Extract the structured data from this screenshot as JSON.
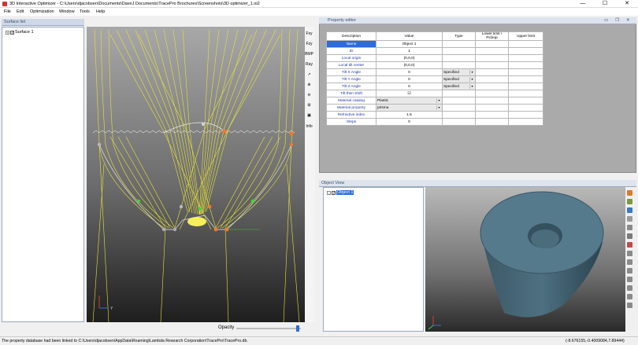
{
  "window": {
    "title": "3D Interactive Optimizer - C:\\Users\\djacobsen\\Documents\\DaveJ Documents\\TracePro Brochures\\Screenshots\\3D optimizer_1.io2",
    "minimize": "—",
    "maximize": "☐",
    "close": "✕"
  },
  "menu": [
    "File",
    "Edit",
    "Optimization",
    "Window",
    "Tools",
    "Help"
  ],
  "surface_list": {
    "header": "Surface list",
    "items": [
      {
        "expander": "+",
        "checked": "✓",
        "label": "Surface 1"
      }
    ]
  },
  "viewport": {
    "opacity_label": "Opacity",
    "opacity_value": 0.95,
    "axis_label": "Y",
    "tools": [
      "Fxy",
      "Fzy",
      "BMP",
      "Ray",
      "↗",
      "⊕",
      "⊖",
      "⊞",
      "▣",
      "Info"
    ]
  },
  "property_editor": {
    "header": "Property editor",
    "columns": [
      "Description",
      "Value",
      "Type",
      "Lower limit / Pickup",
      "Upper limit"
    ],
    "rows": [
      {
        "desc": "Name",
        "value": "Object 1",
        "type": "",
        "selected": true
      },
      {
        "desc": "ID",
        "value": "1",
        "type": ""
      },
      {
        "desc": "Local origin",
        "value": "(0,0,0)",
        "type": ""
      },
      {
        "desc": "Local tilt center",
        "value": "(0,0,0)",
        "type": ""
      },
      {
        "desc": "Tilt X Angle",
        "value": "0",
        "type": "Specified"
      },
      {
        "desc": "Tilt Y Angle",
        "value": "0",
        "type": "Specified"
      },
      {
        "desc": "Tilt Z Angle",
        "value": "0",
        "type": "Specified"
      },
      {
        "desc": "Tilt then Shift",
        "value": "☑",
        "type": ""
      },
      {
        "desc": "Material catalog",
        "value": "Plastic",
        "type": "",
        "value_dropdown": true
      },
      {
        "desc": "Material property",
        "value": "prisma",
        "type": "",
        "value_dropdown": true
      },
      {
        "desc": "Refractive index",
        "value": "1.5",
        "type": ""
      },
      {
        "desc": "Steps",
        "value": "0",
        "type": ""
      }
    ],
    "window_buttons": [
      "▭",
      "❐",
      "✕"
    ]
  },
  "object_view": {
    "header": "Object View",
    "items": [
      {
        "expander": "-",
        "checked": "✓",
        "label": "Object 1"
      }
    ]
  },
  "status": {
    "message": "The property database had been linked to C:\\Users\\djacobsen\\AppData\\Roaming\\Lambda Research Corporation\\TracePro\\TracePro.db.",
    "coords": "(-8.676155,-0.4009084,7.89444)"
  },
  "colors": {
    "accent": "#2e6bd8",
    "rays": "#e8e23a",
    "object": "#4d7080"
  }
}
